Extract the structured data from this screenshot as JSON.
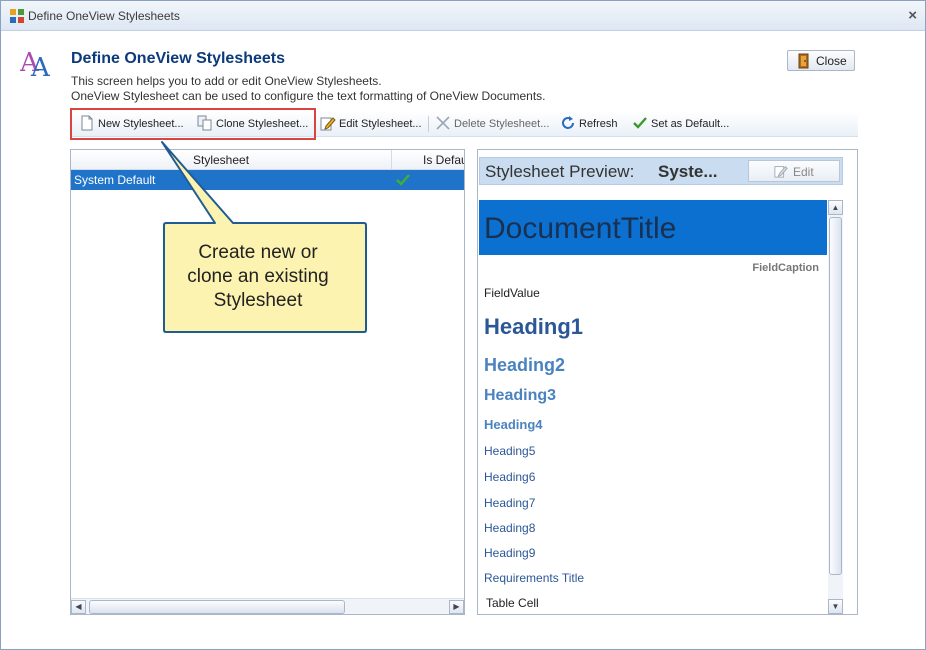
{
  "window": {
    "title": "Define OneView Stylesheets",
    "close_glyph": "×"
  },
  "header": {
    "title": "Define OneView Stylesheets",
    "desc_line1": "This screen helps you to add or edit OneView Stylesheets.",
    "desc_line2": "OneView Stylesheet can be used to configure the text formatting of OneView Documents.",
    "close_label": "Close"
  },
  "toolbar": {
    "new_label": "New Stylesheet...",
    "clone_label": "Clone Stylesheet...",
    "edit_label": "Edit Stylesheet...",
    "delete_label": "Delete Stylesheet...",
    "refresh_label": "Refresh",
    "default_label": "Set as Default..."
  },
  "grid": {
    "columns": [
      "Stylesheet",
      "Is Default"
    ],
    "rows": [
      {
        "name": "System Default",
        "is_default": true
      }
    ]
  },
  "preview": {
    "label": "Stylesheet Preview:",
    "value": "Syste...",
    "edit_label": "Edit",
    "items": {
      "document_title": "DocumentTitle",
      "field_caption": "FieldCaption",
      "field_value": "FieldValue",
      "heading1": "Heading1",
      "heading2": "Heading2",
      "heading3": "Heading3",
      "heading4": "Heading4",
      "heading5": "Heading5",
      "heading6": "Heading6",
      "heading7": "Heading7",
      "heading8": "Heading8",
      "heading9": "Heading9",
      "requirements_title": "Requirements Title",
      "table_cell": "Table Cell"
    }
  },
  "callout": {
    "line1": "Create new or",
    "line2": "clone an existing",
    "line3": "Stylesheet"
  },
  "colors": {
    "selection": "#1f74c9",
    "document_title_bg": "#0b70cf",
    "highlight_border": "#d9443e",
    "callout_fill": "#fdf3b0",
    "callout_border": "#1f5c94"
  }
}
